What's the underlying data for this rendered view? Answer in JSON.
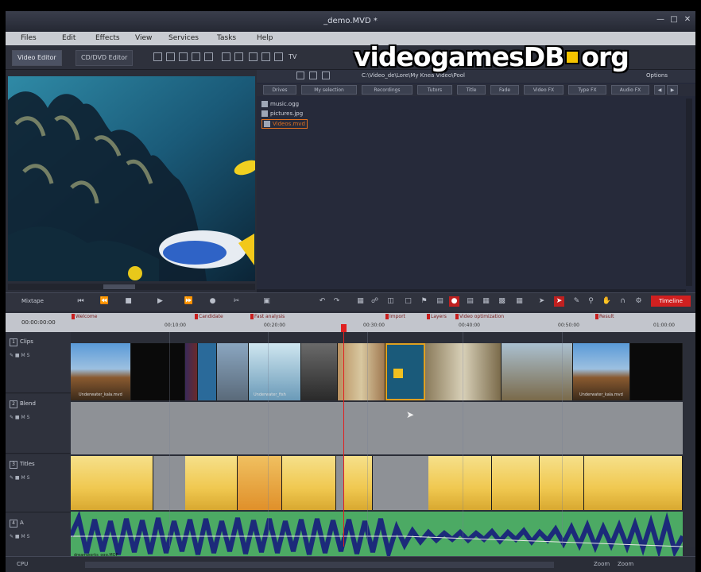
{
  "window": {
    "title": "_demo.MVD *"
  },
  "window_controls": [
    "minimize",
    "maximize",
    "close"
  ],
  "menu": [
    "Files",
    "Edit",
    "Effects",
    "View",
    "Services",
    "Tasks",
    "Help"
  ],
  "toolbar": {
    "tabs": [
      "Video Editor",
      "CD/DVD Editor"
    ],
    "tv_label": "TV"
  },
  "watermark": {
    "left": "videogamesDB",
    "right": "org"
  },
  "browser": {
    "path": "C:\\Video_de\\Lore\\My Knea Video\\Pool",
    "options_label": "Options",
    "tabs": [
      "Drives",
      "My selection",
      "Recordings",
      "Tutors",
      "Title",
      "Fade",
      "Video FX",
      "Type FX",
      "Audio FX"
    ],
    "files": [
      {
        "name": "music.ogg",
        "selected": false
      },
      {
        "name": "pictures.jpg",
        "selected": false
      },
      {
        "name": "Videos.mvd",
        "selected": true
      }
    ]
  },
  "timeline_toolbar": {
    "label": "Mixtape",
    "timeline_button": "Timeline"
  },
  "ruler": {
    "current_time": "00:00:00:00",
    "ticks": [
      "00:10:00",
      "00:20:00",
      "00:30:00",
      "00:40:00",
      "00:50:00",
      "01:00:00"
    ],
    "markers": [
      "Welcome",
      "Candidate",
      "Fast analysis",
      "Import",
      "Layers",
      "Video optimization",
      "Result"
    ]
  },
  "tracks": [
    {
      "num": "1",
      "name": "Clips",
      "type": "video"
    },
    {
      "num": "2",
      "name": "Blend",
      "type": "empty"
    },
    {
      "num": "3",
      "name": "Titles",
      "type": "title"
    },
    {
      "num": "4",
      "name": "A",
      "type": "audio"
    }
  ],
  "clip_labels": {
    "video_first": "Underwater_kala.mvd",
    "video_mid": "Underwater_fish",
    "video_last": "Underwater_kala.mvd",
    "audio": "dreamworks_ogg.MOP"
  },
  "statusbar": {
    "left": "CPU",
    "zoom_label": "Zoom",
    "zoom_value": "Zoom"
  },
  "colors": {
    "marker_flag": "#c81e1e",
    "playhead": "#e02020",
    "title_track": "#f0c850",
    "audio_wave": "#1c2a7a",
    "audio_bg": "#4caa64",
    "selection": "#e07020"
  }
}
